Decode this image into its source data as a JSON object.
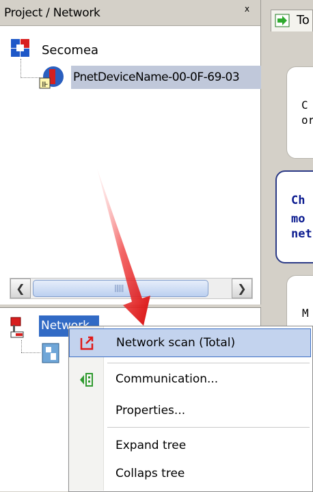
{
  "project_panel": {
    "title": "Project / Network",
    "tree": {
      "root_label": "Secomea",
      "child_label": "PnetDeviceName-00-0F-69-03"
    }
  },
  "network_panel": {
    "root_label": "Network"
  },
  "right_panel": {
    "tab_label": "To",
    "card1_lines": [
      "C",
      "or"
    ],
    "card2_lines": [
      "Ch",
      "mo",
      "net"
    ],
    "card3_lines": [
      "M"
    ]
  },
  "context_menu": {
    "items": [
      {
        "label": "Network scan (Total)",
        "icon": "network-scan-icon",
        "highlighted": true
      },
      {
        "label": "Communication...",
        "icon": "communication-icon"
      },
      {
        "label": "Properties..."
      },
      {
        "label": "Expand tree"
      },
      {
        "label": "Collaps tree"
      }
    ]
  },
  "colors": {
    "selection_blue": "#316ac5",
    "menu_highlight": "#c3d3ee",
    "card_text_blue": "#0a1a8f",
    "arrow_red": "#e02020"
  }
}
